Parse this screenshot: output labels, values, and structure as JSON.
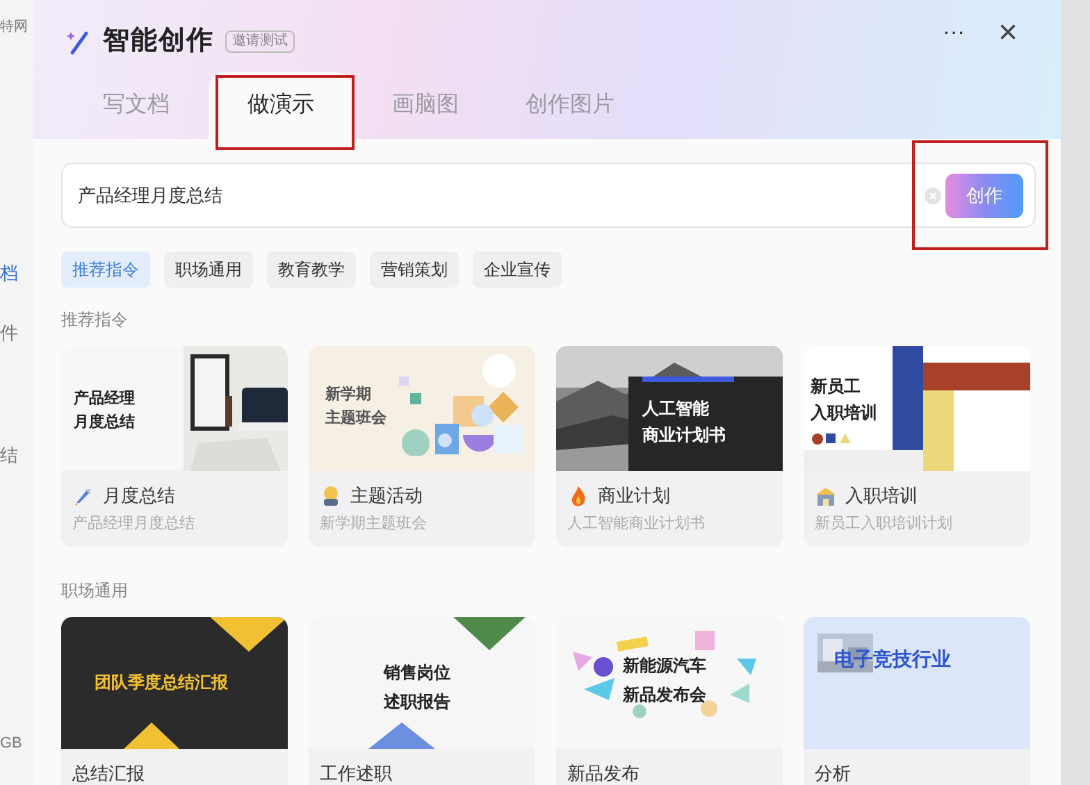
{
  "background_app": {
    "items": [
      {
        "label": "特网",
        "selected": false
      },
      {
        "label": "档",
        "selected": true
      },
      {
        "label": "件",
        "selected": false
      },
      {
        "label": "结",
        "selected": false
      },
      {
        "label": "GB",
        "selected": false
      }
    ]
  },
  "dialog": {
    "title": "智能创作",
    "badge": "邀请测试",
    "more": "···",
    "close": "×"
  },
  "tabs": [
    {
      "label": "写文档",
      "selected": false,
      "boxed": false
    },
    {
      "label": "做演示",
      "selected": true,
      "boxed": true
    },
    {
      "label": "画脑图",
      "selected": false,
      "boxed": false
    },
    {
      "label": "创作图片",
      "selected": false,
      "boxed": false
    }
  ],
  "prompt": {
    "value": "产品经理月度总结",
    "button": "创作",
    "boxed": true
  },
  "chips": [
    {
      "label": "推荐指令",
      "selected": true
    },
    {
      "label": "职场通用",
      "selected": false
    },
    {
      "label": "教育教学",
      "selected": false
    },
    {
      "label": "营销策划",
      "selected": false
    },
    {
      "label": "企业宣传",
      "selected": false
    }
  ],
  "sections": [
    {
      "title": "推荐指令",
      "cards": [
        {
          "kind": "notebook",
          "thumb_lines": [
            "产品经理",
            "月度总结"
          ],
          "title": "月度总结",
          "subtitle": "产品经理月度总结"
        },
        {
          "kind": "shapes",
          "thumb_lines": [
            "新学期",
            "主题班会"
          ],
          "title": "主题活动",
          "subtitle": "新学期主题班会"
        },
        {
          "kind": "mountain",
          "thumb_lines": [
            "人工智能",
            "商业计划书"
          ],
          "title": "商业计划",
          "subtitle": "人工智能商业计划书"
        },
        {
          "kind": "blocks",
          "thumb_lines": [
            "新员工",
            "入职培训"
          ],
          "title": "入职培训",
          "subtitle": "新员工入职培训计划"
        }
      ]
    },
    {
      "title": "职场通用",
      "cards": [
        {
          "kind": "dark",
          "thumb_lines": [
            "团队季度总结汇报"
          ],
          "title": "总结汇报"
        },
        {
          "kind": "triangles",
          "thumb_lines": [
            "销售岗位",
            "述职报告"
          ],
          "title": "工作述职"
        },
        {
          "kind": "confetti",
          "thumb_lines": [
            "新能源汽车",
            "新品发布会"
          ],
          "title": "新品发布"
        },
        {
          "kind": "esports",
          "thumb_lines": [
            "电子竞技行业"
          ],
          "title": "分析"
        }
      ]
    }
  ]
}
